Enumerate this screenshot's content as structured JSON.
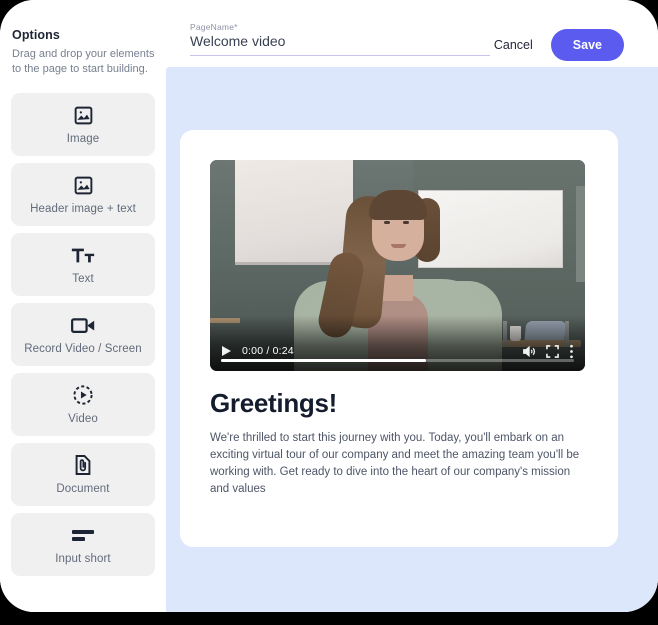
{
  "sidebar": {
    "title": "Options",
    "subtitle": "Drag and drop your elements to the page to start building.",
    "items": [
      {
        "label": "Image",
        "icon": "image-icon"
      },
      {
        "label": "Header image + text",
        "icon": "image-icon"
      },
      {
        "label": "Text",
        "icon": "text-format-icon"
      },
      {
        "label": "Record Video / Screen",
        "icon": "video-camera-icon"
      },
      {
        "label": "Video",
        "icon": "play-circle-dashed-icon"
      },
      {
        "label": "Document",
        "icon": "document-attachment-icon"
      },
      {
        "label": "Input short",
        "icon": "input-short-icon"
      }
    ]
  },
  "header": {
    "field_label": "PageName*",
    "field_value": "Welcome video",
    "field_placeholder": "PageName",
    "cancel_label": "Cancel",
    "save_label": "Save"
  },
  "page": {
    "video": {
      "current_time": "0:00",
      "duration": "0:24",
      "time_display": "0:00 / 0:24",
      "progress_percent": 58
    },
    "heading": "Greetings!",
    "body": "We're thrilled to start this journey with you. Today, you'll embark on an exciting virtual tour of our company and meet the amazing team you'll be working with. Get ready to dive into the heart of our company's mission and values"
  },
  "colors": {
    "accent": "#5b5bf0",
    "canvas": "#dde7fb",
    "tile": "#f0f0f0",
    "ink": "#1d2434"
  }
}
